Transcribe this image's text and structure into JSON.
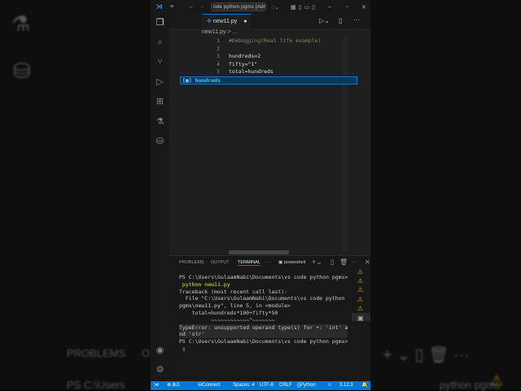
{
  "title": {
    "search": "ode python pgms [Admin]"
  },
  "tab": {
    "label": "new11.py",
    "dirty": "●"
  },
  "breadcrumb": "new11.py > ...",
  "editor": {
    "lines": [
      {
        "n": "1",
        "text": "#Debugging(Real life example)",
        "color": "#6a9955"
      },
      {
        "n": "2",
        "text": "",
        "color": "#ddd"
      },
      {
        "n": "3",
        "text": "hundreds=2",
        "color": "#ddd"
      },
      {
        "n": "4",
        "text": "fifty=\"1\"",
        "color": "#ddd"
      },
      {
        "n": "5",
        "text": "total=hundreds",
        "color": "#ddd"
      }
    ]
  },
  "autocomplete": {
    "item": "hundreds"
  },
  "panel": {
    "tabs": [
      "PROBLEMS",
      "OUTPUT",
      "TERMINAL"
    ],
    "more": "···",
    "shell": "powershell"
  },
  "terminal": {
    "lines": [
      "PS C:\\Users\\GulaamNabi\\Documents\\vs code python pgms>",
      " python new11.py",
      "Traceback (most recent call last):",
      "  File \"C:\\Users\\GulaamNabi\\Documents\\vs code python",
      "pgms\\new11.py\", line 5, in <module>",
      "    total=hundreds*100+fifty*50",
      "          ~~~~~~~~~~~~^~~~~~~~",
      "TypeError: unsupported operand type(s) for +: 'int' a",
      "nd 'str'",
      "PS C:\\Users\\GulaamNabi\\Documents\\vs code python pgms>",
      " ▯"
    ]
  },
  "status": {
    "errors": "0",
    "warnings": "0",
    "connect": "Connect",
    "spaces": "Spaces: 4",
    "encoding": "UTF-8",
    "eol": "CRLF",
    "language": "Python",
    "version": "3.12.3"
  },
  "background": {
    "left_problems": "PROBLEMS",
    "left_o": "O",
    "left_ps": "PS C:\\Users",
    "right_text": "python pgms"
  }
}
